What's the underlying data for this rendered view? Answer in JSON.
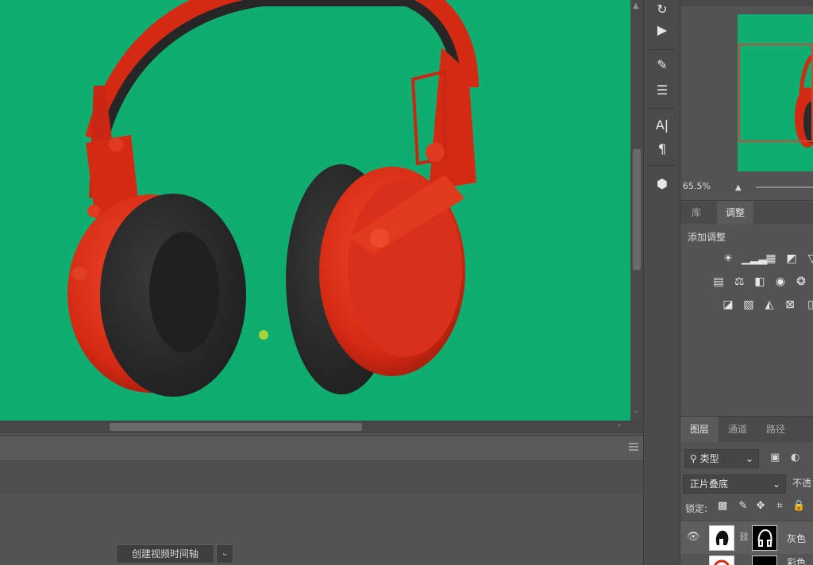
{
  "canvas": {
    "background": "#10ad70"
  },
  "navigator": {
    "zoom": "65.5%"
  },
  "adjustments": {
    "tabs": [
      {
        "label": "库",
        "active": false
      },
      {
        "label": "调整",
        "active": true
      }
    ],
    "title": "添加调整"
  },
  "layers": {
    "tabs": [
      {
        "label": "图层",
        "active": true
      },
      {
        "label": "通道",
        "active": false
      },
      {
        "label": "路径",
        "active": false
      }
    ],
    "filter_kind": "类型",
    "blend_mode": "正片叠底",
    "opacity_label": "不透",
    "lock_label": "锁定:",
    "rows": [
      {
        "name": "灰色",
        "visible": true
      },
      {
        "name": "彩色",
        "visible": true
      }
    ]
  },
  "timeline": {
    "create_button": "创建视频时间轴"
  },
  "colors": {
    "accent_red": "#d42a14",
    "panel": "#535353"
  }
}
